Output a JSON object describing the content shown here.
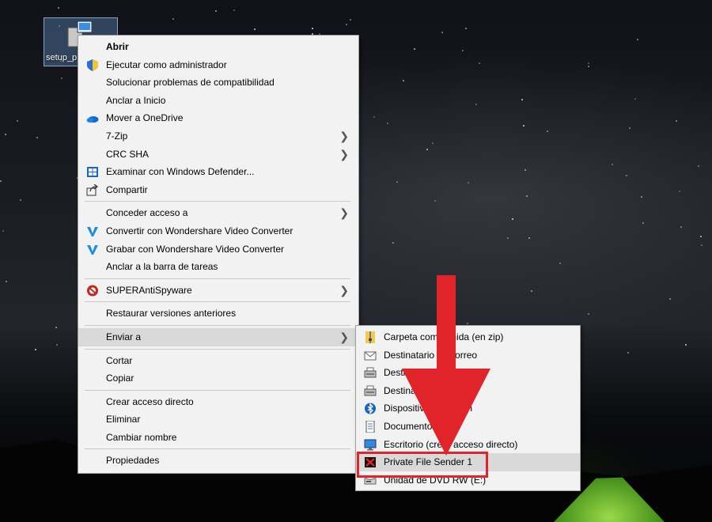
{
  "desktop": {
    "icon_label": "setup_p"
  },
  "context_menu": {
    "groups": [
      [
        {
          "label": "Abrir",
          "icon": "none",
          "bold": true
        },
        {
          "label": "Ejecutar como administrador",
          "icon": "uac-shield-icon"
        },
        {
          "label": "Solucionar problemas de compatibilidad",
          "icon": "none"
        },
        {
          "label": "Anclar a Inicio",
          "icon": "none"
        },
        {
          "label": "Mover a OneDrive",
          "icon": "onedrive-icon"
        },
        {
          "label": "7-Zip",
          "icon": "none",
          "submenu": true
        },
        {
          "label": "CRC SHA",
          "icon": "none",
          "submenu": true
        },
        {
          "label": "Examinar con Windows Defender...",
          "icon": "windows-defender-icon"
        },
        {
          "label": "Compartir",
          "icon": "share-icon"
        }
      ],
      [
        {
          "label": "Conceder acceso a",
          "icon": "none",
          "submenu": true
        },
        {
          "label": "Convertir con Wondershare Video Converter",
          "icon": "wondershare-icon"
        },
        {
          "label": "Grabar con Wondershare Video Converter",
          "icon": "wondershare-icon"
        },
        {
          "label": "Anclar a la barra de tareas",
          "icon": "none"
        }
      ],
      [
        {
          "label": "SUPERAntiSpyware",
          "icon": "superantispyware-icon",
          "submenu": true
        }
      ],
      [
        {
          "label": "Restaurar versiones anteriores",
          "icon": "none"
        }
      ],
      [
        {
          "label": "Enviar a",
          "icon": "none",
          "submenu": true,
          "highlighted": true
        }
      ],
      [
        {
          "label": "Cortar",
          "icon": "none"
        },
        {
          "label": "Copiar",
          "icon": "none"
        }
      ],
      [
        {
          "label": "Crear acceso directo",
          "icon": "none"
        },
        {
          "label": "Eliminar",
          "icon": "none"
        },
        {
          "label": "Cambiar nombre",
          "icon": "none"
        }
      ],
      [
        {
          "label": "Propiedades",
          "icon": "none"
        }
      ]
    ]
  },
  "send_to_menu": {
    "items": [
      {
        "label": "Carpeta comprimida (en zip)",
        "icon": "zip-folder-icon"
      },
      {
        "label": "Destinatario de correo",
        "icon": "mail-icon"
      },
      {
        "label": "Destinatario de fax",
        "icon": "fax-icon"
      },
      {
        "label": "Destinatario de fax",
        "icon": "fax-icon"
      },
      {
        "label": "Dispositivo Bluetooth",
        "icon": "bluetooth-icon"
      },
      {
        "label": "Documentos",
        "icon": "documents-icon"
      },
      {
        "label": "Escritorio (crear acceso directo)",
        "icon": "desktop-icon"
      },
      {
        "label": "Private File Sender 1",
        "icon": "private-file-sender-icon",
        "highlighted": true
      },
      {
        "label": "Unidad de DVD RW (E:)",
        "icon": "dvd-drive-icon"
      }
    ]
  },
  "colors": {
    "annotation_red": "#e1232a",
    "menu_bg": "#f2f2f2",
    "highlight": "#d9d9d9"
  }
}
